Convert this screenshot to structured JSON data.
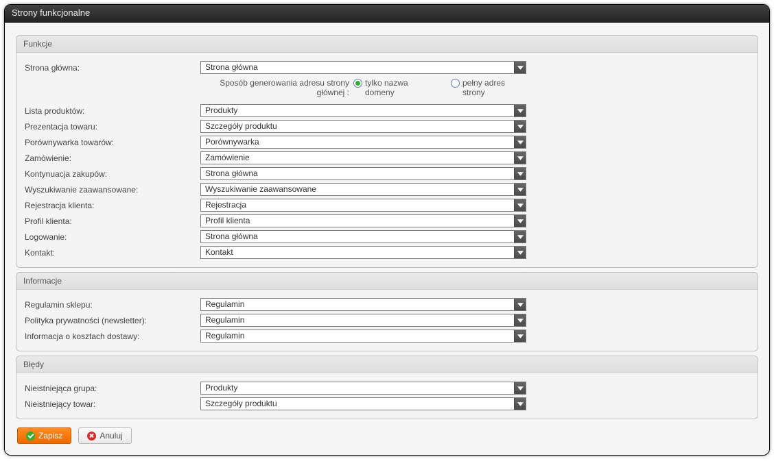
{
  "title": "Strony funkcjonalne",
  "sections": {
    "funkcje": {
      "header": "Funkcje",
      "rows": [
        {
          "label": "Strona główna:",
          "value": "Strona główna"
        }
      ],
      "address_mode": {
        "label": "Sposób generowania adresu strony głównej :",
        "opt1": "tylko nazwa domeny",
        "opt2": "pełny adres strony",
        "selected": 1
      },
      "rows2": [
        {
          "label": "Lista produktów:",
          "value": "Produkty"
        },
        {
          "label": "Prezentacja towaru:",
          "value": "Szczegóły produktu"
        },
        {
          "label": "Porównywarka towarów:",
          "value": "Porównywarka"
        },
        {
          "label": "Zamówienie:",
          "value": "Zamówienie"
        },
        {
          "label": "Kontynuacja zakupów:",
          "value": "Strona główna"
        },
        {
          "label": "Wyszukiwanie zaawansowane:",
          "value": "Wyszukiwanie zaawansowane"
        },
        {
          "label": "Rejestracja klienta:",
          "value": "Rejestracja"
        },
        {
          "label": "Profil klienta:",
          "value": "Profil klienta"
        },
        {
          "label": "Logowanie:",
          "value": "Strona główna"
        },
        {
          "label": "Kontakt:",
          "value": "Kontakt"
        }
      ]
    },
    "informacje": {
      "header": "Informacje",
      "rows": [
        {
          "label": "Regulamin sklepu:",
          "value": "Regulamin"
        },
        {
          "label": "Polityka prywatności (newsletter):",
          "value": "Regulamin"
        },
        {
          "label": "Informacja o kosztach dostawy:",
          "value": "Regulamin"
        }
      ]
    },
    "bledy": {
      "header": "Błędy",
      "rows": [
        {
          "label": "Nieistniejąca grupa:",
          "value": "Produkty"
        },
        {
          "label": "Nieistniejący towar:",
          "value": "Szczegóły produktu"
        }
      ]
    }
  },
  "actions": {
    "save": "Zapisz",
    "cancel": "Anuluj"
  }
}
